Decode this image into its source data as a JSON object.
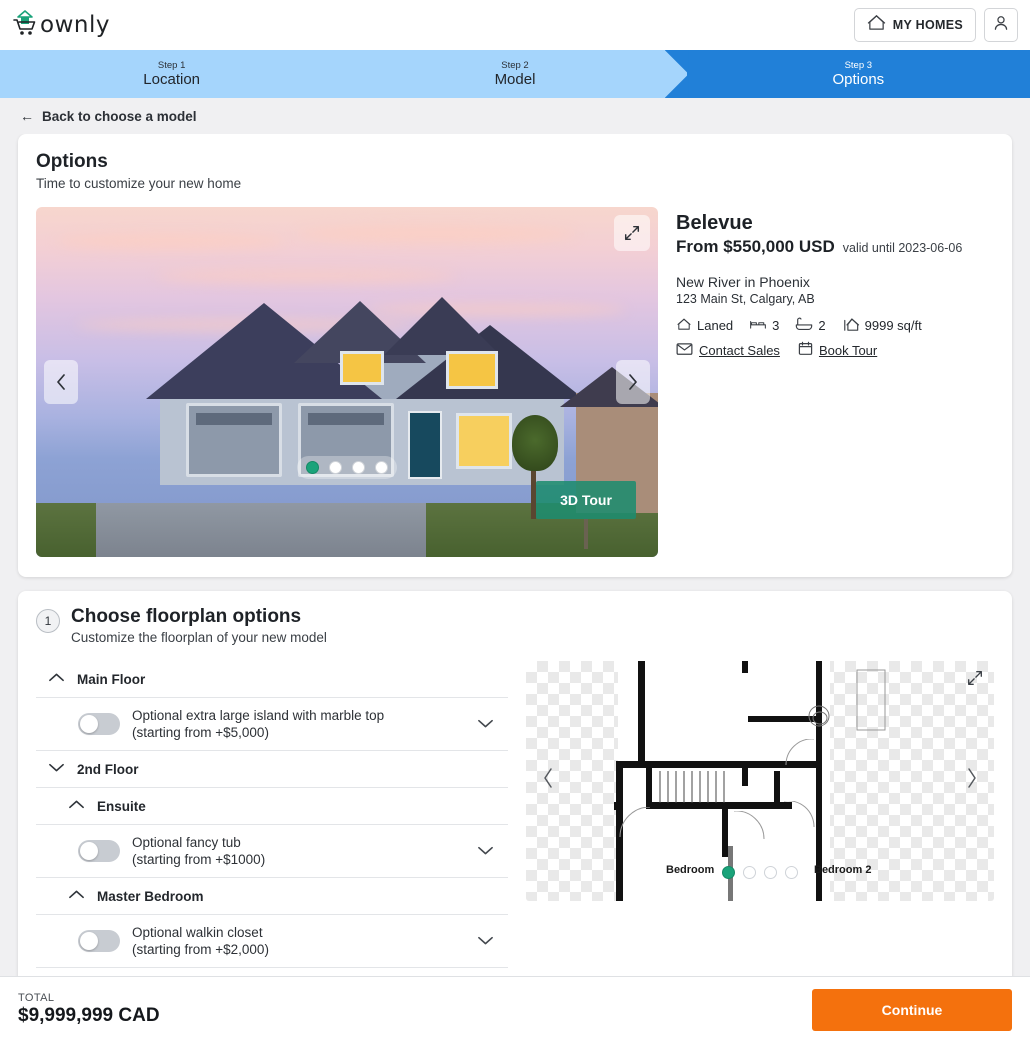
{
  "header": {
    "logo_text": "ownly",
    "logo_icon": "house-cart-icon",
    "my_homes_label": "MY HOMES",
    "my_homes_icon": "house-icon",
    "account_icon": "person-icon"
  },
  "steps": [
    {
      "num": "Step 1",
      "name": "Location",
      "active": false
    },
    {
      "num": "Step 2",
      "name": "Model",
      "active": false
    },
    {
      "num": "Step 3",
      "name": "Options",
      "active": true
    }
  ],
  "back_link": {
    "label": "Back to choose a model",
    "icon": "arrow-left-icon"
  },
  "options_card": {
    "title": "Options",
    "subtitle": "Time to customize your new home",
    "carousel": {
      "expand_icon": "expand-diagonal-icon",
      "prev_icon": "chevron-left-icon",
      "next_icon": "chevron-right-icon",
      "tour_label": "3D Tour",
      "dots": 4,
      "active_dot": 0
    },
    "property": {
      "name": "Belevue",
      "price": "From $550,000 USD",
      "valid": "valid until 2023-06-06",
      "community": "New River in Phoenix",
      "address": "123 Main St, Calgary, AB",
      "specs": [
        {
          "icon": "house-icon",
          "value": "Laned"
        },
        {
          "icon": "bed-icon",
          "value": "3"
        },
        {
          "icon": "bathtub-icon",
          "value": "2"
        },
        {
          "icon": "area-icon",
          "value": "9999 sq/ft"
        }
      ],
      "actions": [
        {
          "icon": "envelope-icon",
          "label": "Contact Sales"
        },
        {
          "icon": "calendar-icon",
          "label": "Book Tour"
        }
      ]
    }
  },
  "floorplan_card": {
    "badge": "1",
    "title": "Choose floorplan options",
    "subtitle": "Customize the floorplan of your new model",
    "groups": [
      {
        "label": "Main Floor",
        "level": 1,
        "expanded": true,
        "chevron": "chevron-up-icon",
        "options": [
          {
            "line1": "Optional extra large island with marble top",
            "line2": "(starting from +$5,000)",
            "enabled": false,
            "chevron": "chevron-down-icon"
          }
        ]
      },
      {
        "label": "2nd Floor",
        "level": 1,
        "expanded": false,
        "chevron": "chevron-down-icon",
        "options": []
      },
      {
        "label": "Ensuite",
        "level": 2,
        "expanded": true,
        "chevron": "chevron-up-icon",
        "options": [
          {
            "line1": "Optional fancy tub",
            "line2": "(starting from +$1000)",
            "enabled": false,
            "chevron": "chevron-down-icon"
          }
        ]
      },
      {
        "label": "Master Bedroom",
        "level": 2,
        "expanded": true,
        "chevron": "chevron-up-icon",
        "options": [
          {
            "line1": "Optional walkin closet",
            "line2": "(starting from +$2,000)",
            "enabled": false,
            "chevron": "chevron-down-icon"
          }
        ]
      }
    ],
    "viewer": {
      "expand_icon": "expand-diagonal-icon",
      "prev_icon": "chevron-left-icon",
      "next_icon": "chevron-right-icon",
      "room_label_1": "Bedroom",
      "room_label_2": "Bedroom 2",
      "dots": 4,
      "active_dot": 0
    }
  },
  "footer": {
    "total_label": "TOTAL",
    "total_value": "$9,999,999 CAD",
    "continue_label": "Continue"
  },
  "colors": {
    "accent_orange": "#f4710d",
    "step_active": "#2180d8",
    "step_inactive": "#a5d5fc",
    "green": "#1aa37a",
    "page_bg": "#f0f0f2"
  }
}
